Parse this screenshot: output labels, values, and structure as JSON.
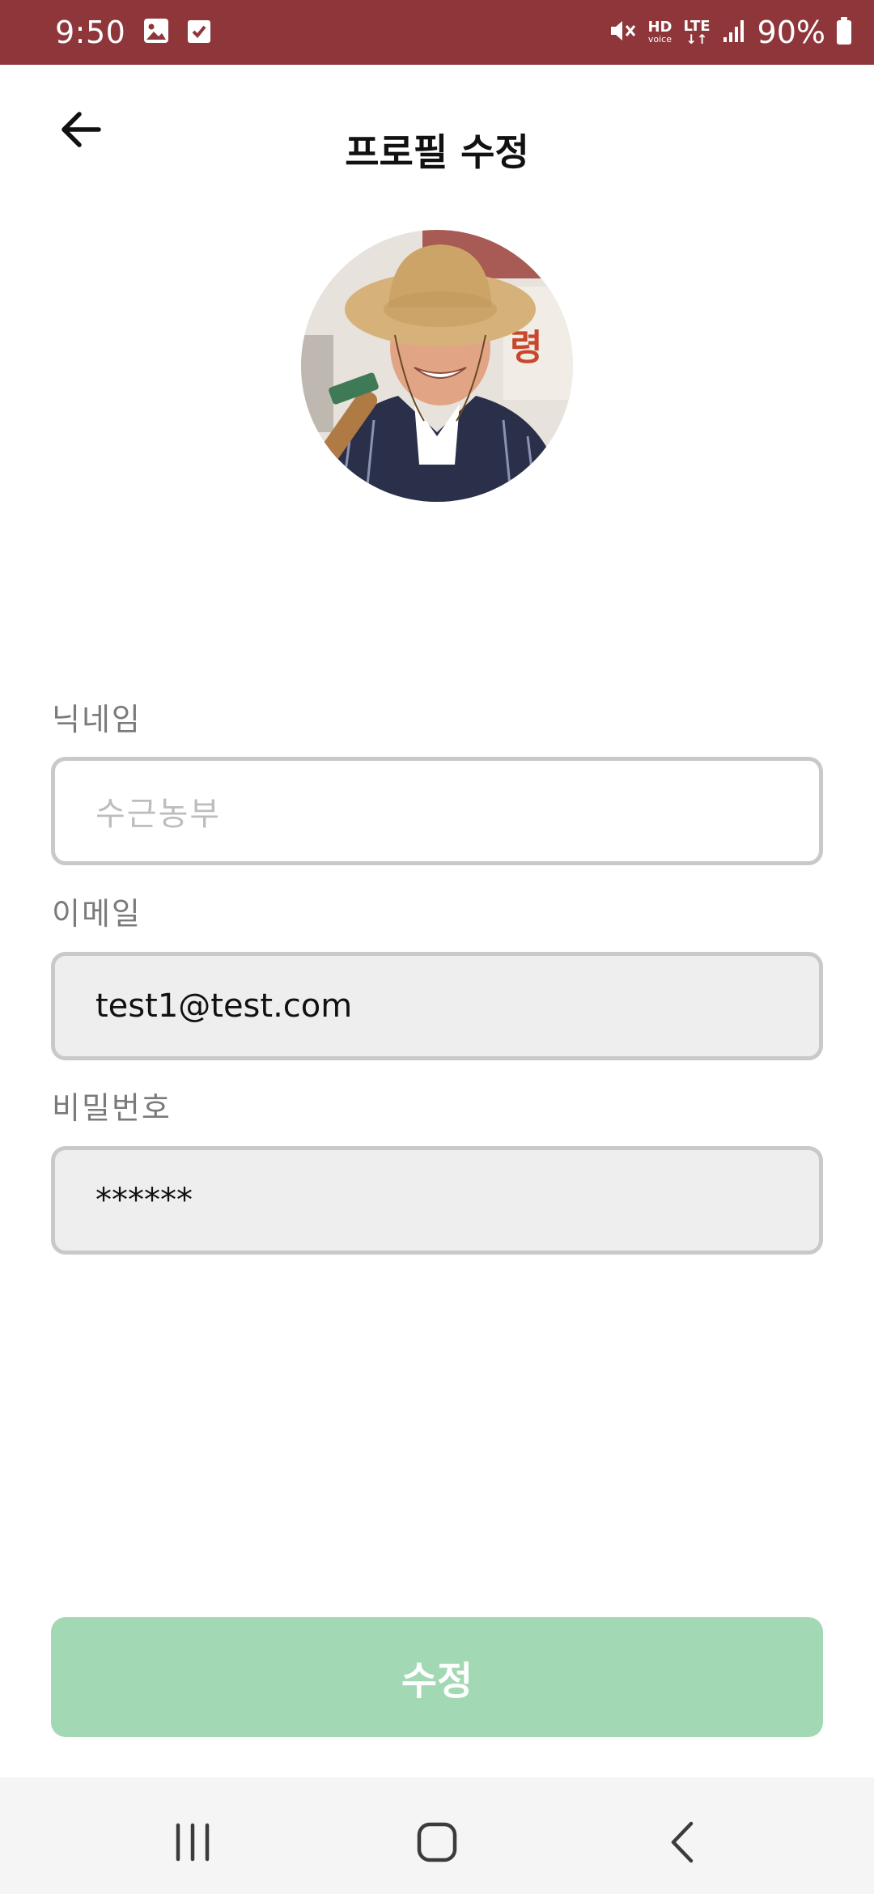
{
  "status_bar": {
    "time": "9:50",
    "left_icons": [
      "gallery-icon",
      "checkbox-icon"
    ],
    "right_icons": [
      "mute-icon",
      "hd-voice-icon",
      "lte-icon",
      "signal-icon",
      "battery-icon"
    ],
    "hd_line1": "HD",
    "hd_line2": "voice",
    "lte": "LTE",
    "battery_text": "90%",
    "battery_level": 0.9,
    "background": "#8e363a"
  },
  "header": {
    "title": "프로필 수정",
    "back_icon": "arrow-left-icon"
  },
  "profile": {
    "avatar_icon": "profile-photo"
  },
  "form": {
    "nickname": {
      "label": "닉네임",
      "placeholder": "수근농부",
      "value": ""
    },
    "email": {
      "label": "이메일",
      "value": "test1@test.com"
    },
    "password": {
      "label": "비밀번호",
      "value": "******"
    }
  },
  "submit": {
    "label": "수정",
    "color": "#a2d8b3"
  },
  "nav_bar": {
    "icons": [
      "recent-apps-icon",
      "home-icon",
      "back-icon"
    ]
  }
}
